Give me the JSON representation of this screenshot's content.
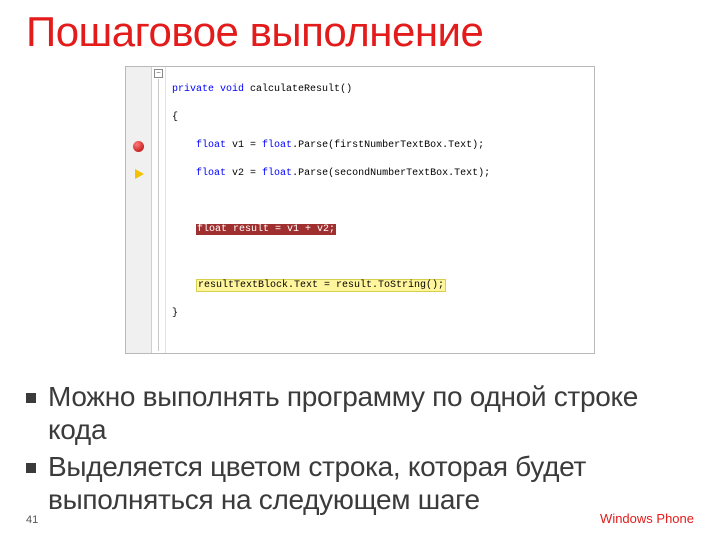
{
  "title": "Пошаговое выполнение",
  "code": {
    "sig_kw1": "private",
    "sig_kw2": "void",
    "sig_name": " calculateResult()",
    "brace_open": "{",
    "l1_a": "float",
    "l1_b": " v1 = ",
    "l1_c": "float",
    "l1_d": ".Parse(firstNumberTextBox.Text);",
    "l2_a": "float",
    "l2_b": " v2 = ",
    "l2_c": "float",
    "l2_d": ".Parse(secondNumberTextBox.Text);",
    "bp_line": "float result = v1 + v2;",
    "cur_line": "resultTextBlock.Text = result.ToString();",
    "brace_close": "}",
    "fold_glyph": "−"
  },
  "bullets": [
    "Можно выполнять программу по одной строке кода",
    "Выделяется цветом строка, которая будет выполняться на следующем шаге"
  ],
  "footer": {
    "page": "41",
    "brand": "Windows Phone"
  }
}
